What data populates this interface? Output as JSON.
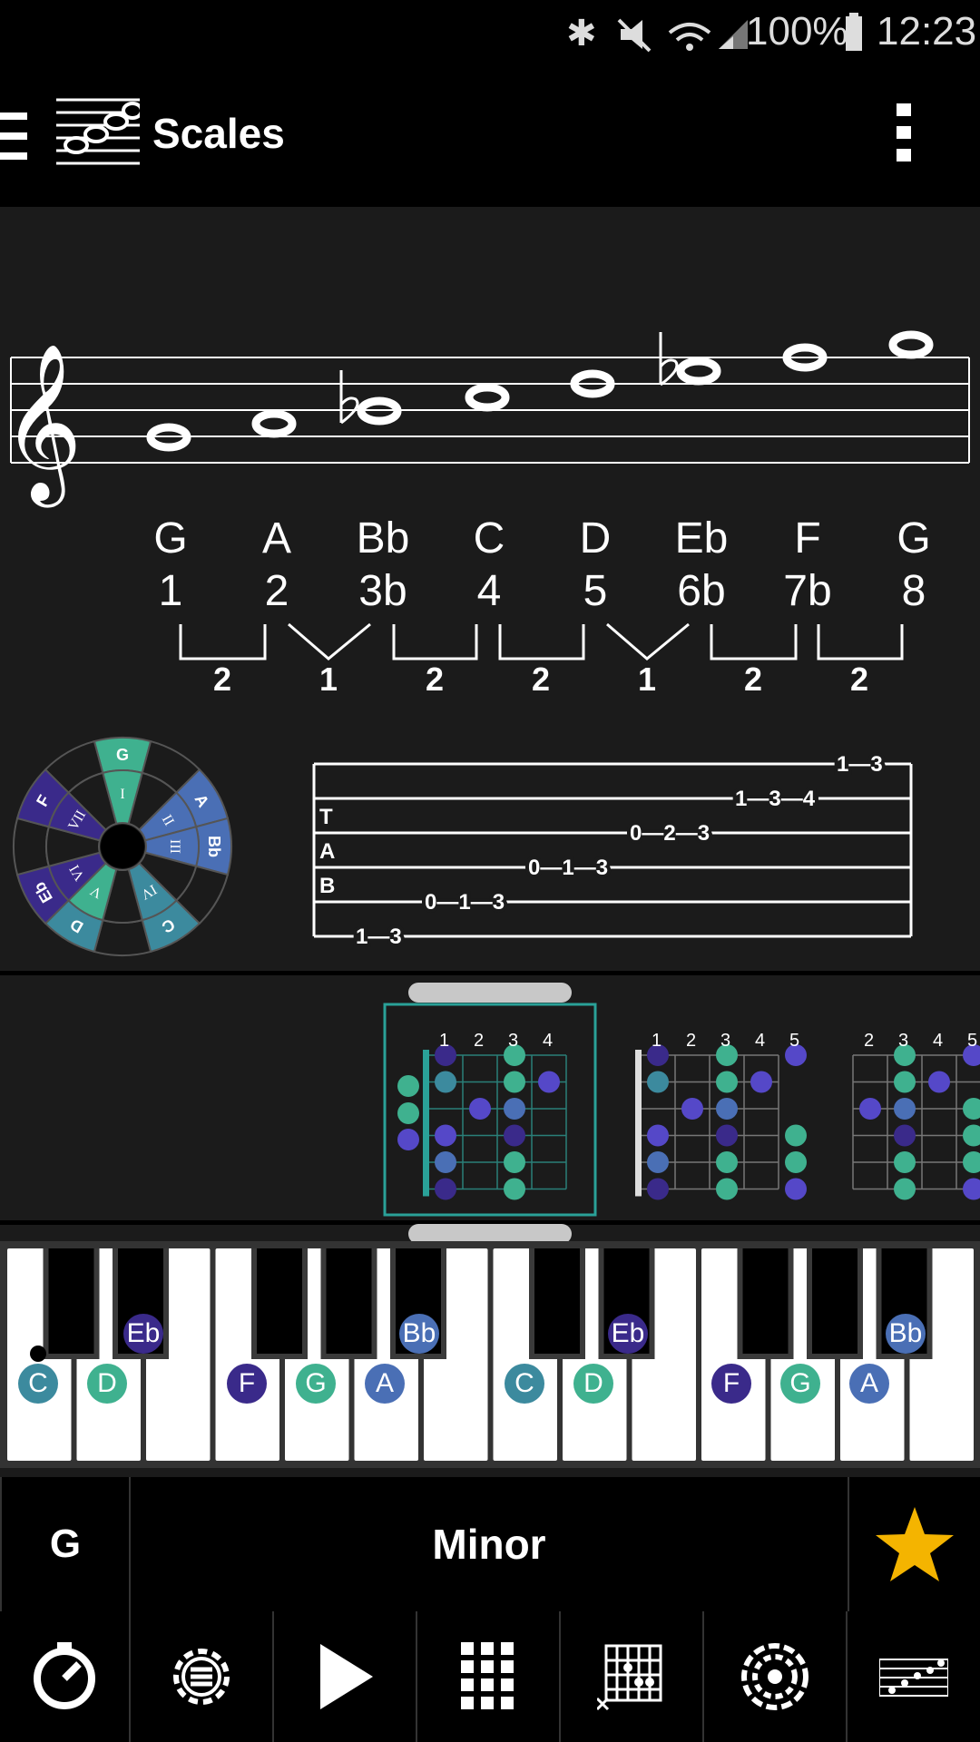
{
  "status": {
    "battery": "100%",
    "time": "12:23"
  },
  "appbar": {
    "title": "Scales"
  },
  "scale": {
    "notes": [
      "G",
      "A",
      "Bb",
      "C",
      "D",
      "Eb",
      "F",
      "G"
    ],
    "degrees": [
      "1",
      "2",
      "3b",
      "4",
      "5",
      "6b",
      "7b",
      "8"
    ],
    "intervals": [
      "2",
      "1",
      "2",
      "2",
      "1",
      "2",
      "2"
    ]
  },
  "wheel": {
    "outer": [
      "G",
      "A",
      "Bb",
      "C",
      "D",
      "Eb",
      "F"
    ],
    "roman": [
      "I",
      "II",
      "III",
      "IV",
      "V",
      "VI",
      "VII"
    ]
  },
  "tab": {
    "clef": [
      "T",
      "A",
      "B"
    ],
    "strings": [
      "1—3",
      "1—3—4",
      "0—2—3",
      "0—1—3",
      "0—1—3",
      "1—3"
    ]
  },
  "fret_diagrams": {
    "d1_numbers": [
      "1",
      "2",
      "3",
      "4"
    ],
    "d2_numbers": [
      "1",
      "2",
      "3",
      "4",
      "5"
    ],
    "d3_numbers": [
      "2",
      "3",
      "4",
      "5"
    ]
  },
  "keyboard": {
    "labels": [
      "C",
      "D",
      "Eb",
      "F",
      "G",
      "A",
      "Bb",
      "C",
      "D",
      "Eb",
      "F",
      "G",
      "A",
      "Bb"
    ]
  },
  "selector": {
    "key": "G",
    "scale_name": "Minor",
    "favorite_icon": "star-icon"
  },
  "toolbar": {
    "icons": [
      "metronome-icon",
      "settings-icon",
      "play-icon",
      "grid-icon",
      "chord-chart-icon",
      "wheel-icon",
      "staff-icon"
    ]
  },
  "colors": {
    "teal": "#3fb18f",
    "blue": "#4a6fb5",
    "purple": "#3a2a8a",
    "cyan": "#3c8a9e",
    "star": "#f4b400"
  }
}
